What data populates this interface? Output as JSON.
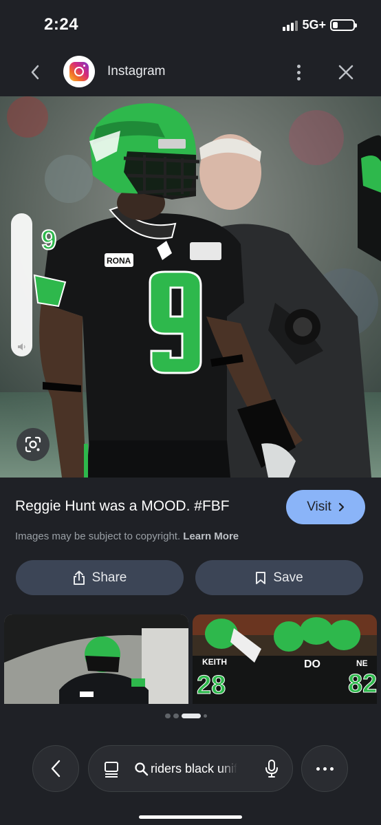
{
  "status_bar": {
    "time": "2:24",
    "network": "5G+",
    "battery_level": 0.25
  },
  "header": {
    "back_icon": "chevron-left-icon",
    "source_logo": "instagram-logo",
    "source_name": "Instagram",
    "more_icon": "more-vertical-icon",
    "close_icon": "close-icon"
  },
  "image_view": {
    "main_image": "football player in black and green #9 jersey",
    "lens_icon": "google-lens-icon",
    "volume_level": 1.0
  },
  "result": {
    "caption": "Reggie Hunt was a MOOD. #FBF",
    "visit_label": "Visit",
    "copyright_text": "Images may be subject to copyright.",
    "learn_more": "Learn More"
  },
  "actions": {
    "share_label": "Share",
    "save_label": "Save"
  },
  "related": {
    "jersey_texts": [
      "KEITH",
      "28",
      "DO",
      "NE",
      "82"
    ]
  },
  "pagination": {
    "page_count": 4,
    "active_index": 2
  },
  "bottom_nav": {
    "search_query": "riders black uniform",
    "back_icon": "chevron-left-icon",
    "tabs_icon": "tabs-icon",
    "search_icon": "search-icon",
    "mic_icon": "mic-icon",
    "more_icon": "more-horizontal-icon"
  },
  "colors": {
    "background": "#1f2126",
    "accent": "#8ab4f8",
    "button_bg": "#3c4556",
    "team_green": "#2eb84c"
  }
}
